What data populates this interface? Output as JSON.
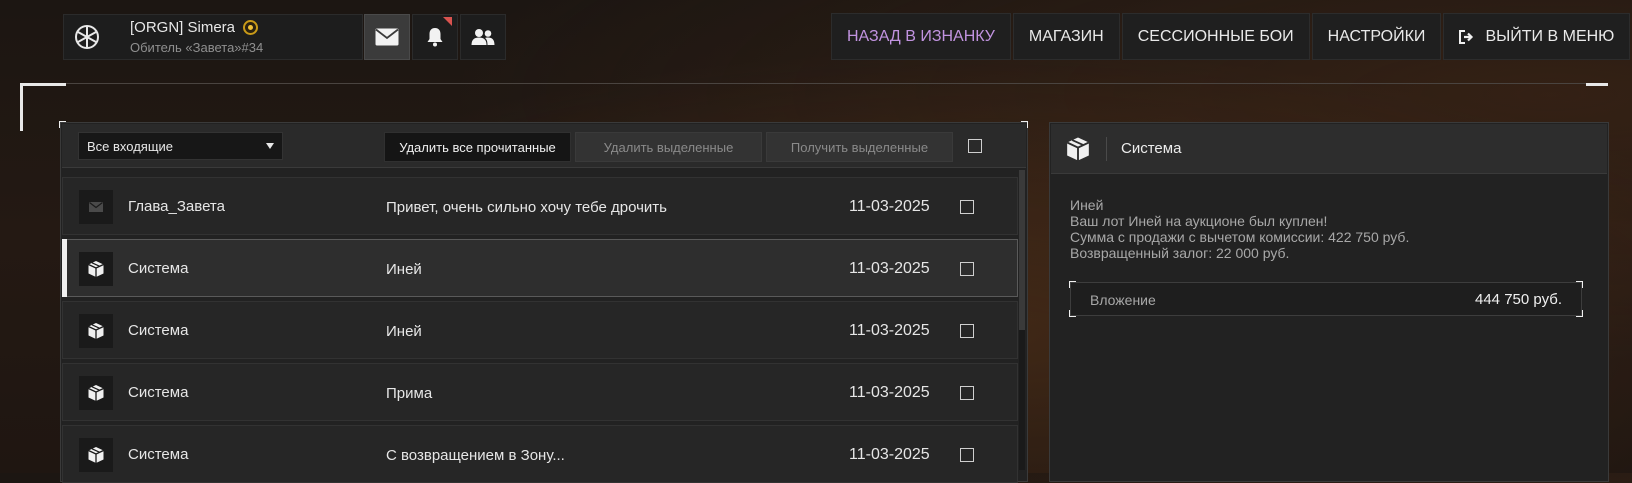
{
  "profile": {
    "name": "[ORGN] Simera",
    "subtitle": "Обитель «Завета»#34"
  },
  "top_nav": {
    "back": "НАЗАД В ИЗНАНКУ",
    "shop": "МАГАЗИН",
    "session": "СЕССИОННЫЕ БОИ",
    "settings": "НАСТРОЙКИ",
    "exit": "ВЫЙТИ В МЕНЮ"
  },
  "colors": {
    "accent": "#c193e0",
    "notification": "#d9534f"
  },
  "toolbar": {
    "filter_value": "Все входящие",
    "delete_read": "Удалить все прочитанные",
    "delete_selected": "Удалить выделенные",
    "get_selected": "Получить выделенные"
  },
  "messages": [
    {
      "sender": "Глава_Завета",
      "subject": "Привет, очень сильно хочу тебе дрочить",
      "date": "11-03-2025",
      "icon": "envelope-icon"
    },
    {
      "sender": "Система",
      "subject": "Иней",
      "date": "11-03-2025",
      "icon": "package-icon"
    },
    {
      "sender": "Система",
      "subject": "Иней",
      "date": "11-03-2025",
      "icon": "package-icon"
    },
    {
      "sender": "Система",
      "subject": "Прима",
      "date": "11-03-2025",
      "icon": "package-icon"
    },
    {
      "sender": "Система",
      "subject": "С возвращением в Зону...",
      "date": "11-03-2025",
      "icon": "package-icon"
    }
  ],
  "detail": {
    "sender": "Система",
    "lines": [
      "Иней",
      "Ваш лот Иней на аукционе был куплен!",
      "Сумма с продажи с вычетом комиссии: 422 750 руб.",
      "Возвращенный залог: 22 000 руб."
    ],
    "attachment_label": "Вложение",
    "attachment_value": "444 750 руб."
  }
}
